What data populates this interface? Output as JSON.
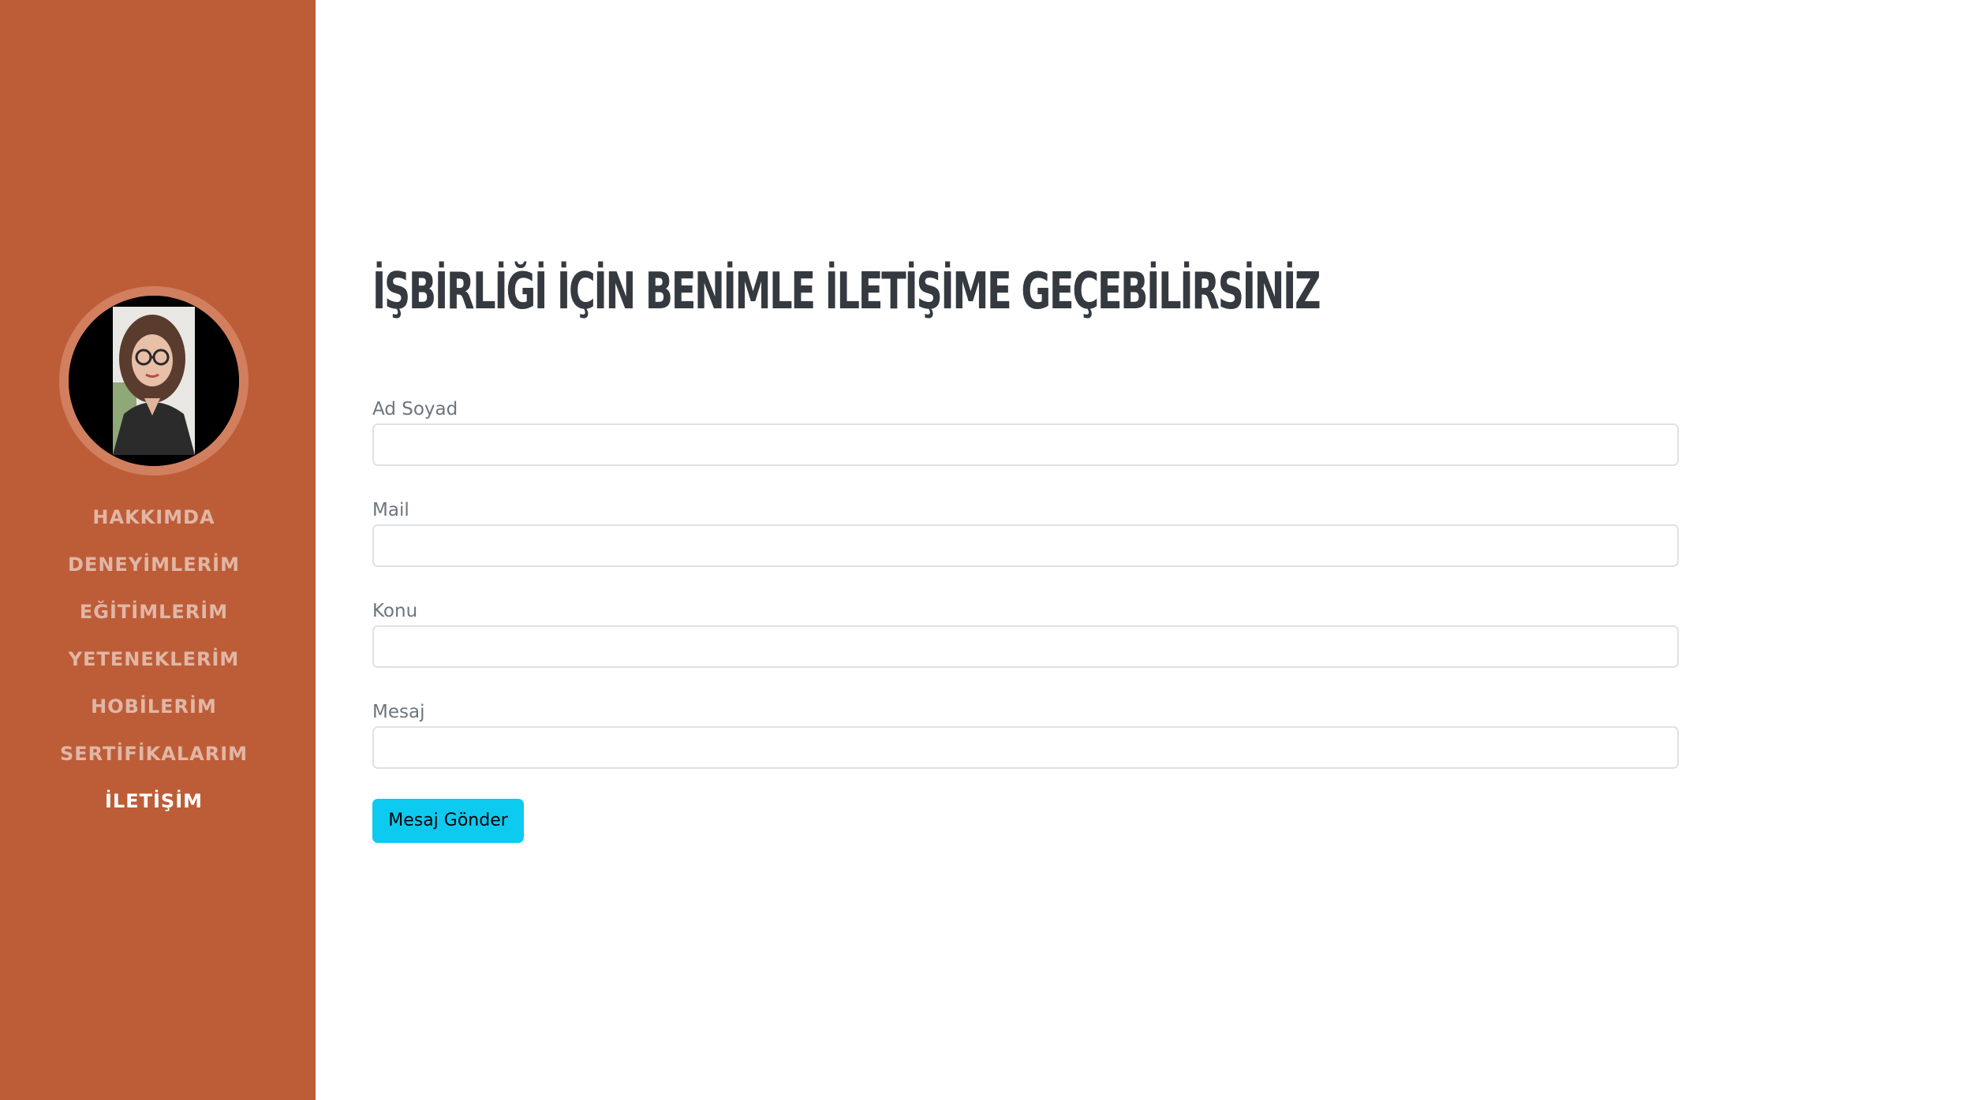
{
  "sidebar": {
    "avatar_alt": "profile photo",
    "nav": [
      {
        "label": "HAKKIMDA",
        "active": false
      },
      {
        "label": "DENEYİMLERİM",
        "active": false
      },
      {
        "label": "EĞİTİMLERİM",
        "active": false
      },
      {
        "label": "YETENEKLERİM",
        "active": false
      },
      {
        "label": "HOBİLERİM",
        "active": false
      },
      {
        "label": "SERTİFİKALARIM",
        "active": false
      },
      {
        "label": "İLETİŞİM",
        "active": true
      }
    ]
  },
  "main": {
    "heading": "İŞBİRLİĞİ İÇİN BENİMLE İLETİŞİME GEÇEBİLİRSİNİZ",
    "fields": [
      {
        "label": "Ad Soyad",
        "value": ""
      },
      {
        "label": "Mail",
        "value": ""
      },
      {
        "label": "Konu",
        "value": ""
      },
      {
        "label": "Mesaj",
        "value": ""
      }
    ],
    "submit_label": "Mesaj Gönder"
  },
  "colors": {
    "sidebar_bg": "#bd5d38",
    "heading": "#343a40",
    "button_bg": "#0dcaf0"
  }
}
